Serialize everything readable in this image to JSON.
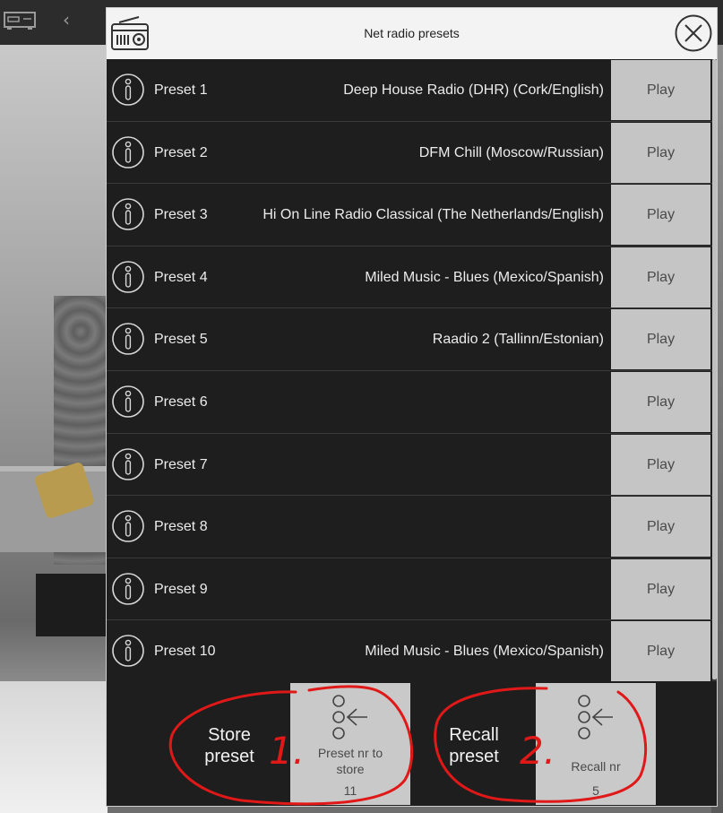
{
  "window": {
    "title": "Net radio presets"
  },
  "presets": [
    {
      "label": "Preset 1",
      "station": "Deep House Radio (DHR) (Cork/English)",
      "play_label": "Play"
    },
    {
      "label": "Preset 2",
      "station": "DFM Chill (Moscow/Russian)",
      "play_label": "Play"
    },
    {
      "label": "Preset 3",
      "station": "Hi On Line Radio Classical (The Netherlands/English)",
      "play_label": "Play"
    },
    {
      "label": "Preset 4",
      "station": "Miled Music - Blues (Mexico/Spanish)",
      "play_label": "Play"
    },
    {
      "label": "Preset 5",
      "station": "Raadio 2 (Tallinn/Estonian)",
      "play_label": "Play"
    },
    {
      "label": "Preset 6",
      "station": "",
      "play_label": "Play"
    },
    {
      "label": "Preset 7",
      "station": "",
      "play_label": "Play"
    },
    {
      "label": "Preset 8",
      "station": "",
      "play_label": "Play"
    },
    {
      "label": "Preset 9",
      "station": "",
      "play_label": "Play"
    },
    {
      "label": "Preset 10",
      "station": "Miled Music - Blues (Mexico/Spanish)",
      "play_label": "Play"
    }
  ],
  "footer": {
    "store": {
      "label_line1": "Store",
      "label_line2": "preset",
      "caption_line1": "Preset nr to",
      "caption_line2": "store",
      "value": "11"
    },
    "recall": {
      "label_line1": "Recall",
      "label_line2": "preset",
      "caption": "Recall nr",
      "value": "5"
    }
  },
  "annotations": {
    "step1": "1.",
    "step2": "2."
  },
  "icons": {
    "header": "radio-icon",
    "close": "close-icon",
    "row": "info-icon",
    "tile": "preset-select-icon"
  },
  "colors": {
    "annotation": "#e01818",
    "play_button": "#c5c5c5",
    "row_background": "#1e1e1e"
  }
}
